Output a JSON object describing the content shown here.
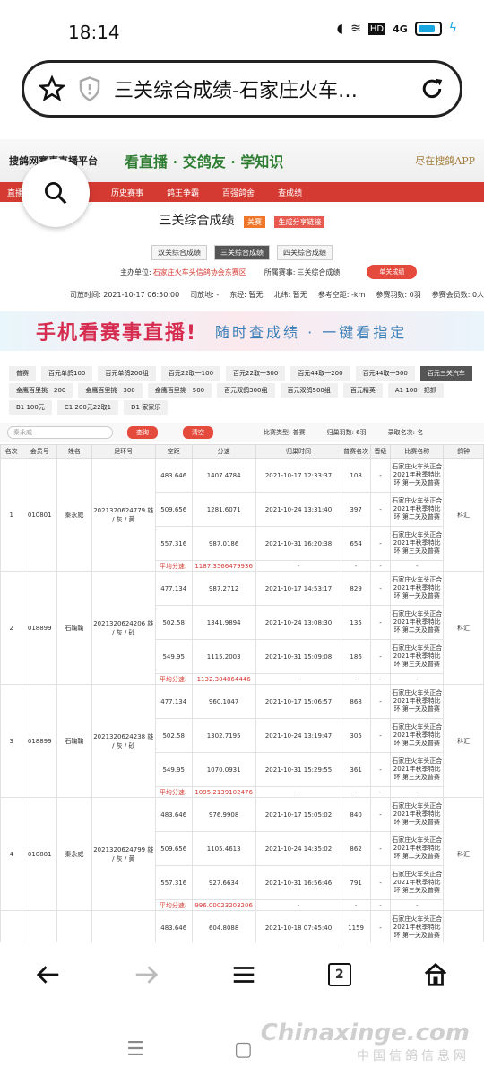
{
  "status": {
    "time": "18:14",
    "net": "HD",
    "signal": "4G"
  },
  "browser": {
    "title": "三关综合成绩-石家庄火车…",
    "tab_count": "2"
  },
  "site": {
    "brand": "搜鸽网赛事直播平台",
    "slogan": "看直播 · 交鸽友 · 学知识",
    "slogan2": "尽在搜鸽APP",
    "nav": [
      "直播",
      "历史赛事",
      "鸽王争霸",
      "百强鸽舍",
      "查成绩"
    ]
  },
  "page": {
    "title": "三关综合成绩",
    "tag_race": "关赛",
    "tag_share": "生成分享链接",
    "tabs": [
      "双关综合成绩",
      "三关综合成绩",
      "四关综合成绩"
    ],
    "organizer_label": "主办单位:",
    "organizer": "石家庄火车头信鸽协会东赛区",
    "match_label": "所属赛事:",
    "match": "三关综合成绩",
    "single_btn": "单关成绩",
    "release_time": "司放时间: 2021-10-17 06:50:00",
    "release_place": "司放地: -",
    "east": "东经: 暂无",
    "north": "北纬: 暂无",
    "ref_dist": "参考空距: -km",
    "ref_feathers": "参赛羽数: 0羽",
    "ref_members": "参赛会员数: 0人"
  },
  "banner": {
    "left": "手机看赛事直播!",
    "right": "随时查成绩 · 一键看指定"
  },
  "categories": [
    "普赛",
    "百元单鸽100",
    "百元单鸽200组",
    "百元22取一100",
    "百元22取一300",
    "百元44取一200",
    "百元44取一500",
    "百元三关汽车",
    "金鹰百里挑一200",
    "金鹰百里挑一300",
    "金鹰百里挑一500",
    "百元双鸽300组",
    "百元双鸽500组",
    "百元精英",
    "A1 100一把抓",
    "B1 100元",
    "C1 200元22取1",
    "D1 家家乐"
  ],
  "filters": {
    "search_value": "秦永威",
    "query_btn": "查询",
    "clear_btn": "清空",
    "type": "比赛类型: 普赛",
    "feathers": "归巢羽数: 6羽",
    "take": "录取名次: 名"
  },
  "table": {
    "headers": [
      "名次",
      "会员号",
      "姓名",
      "足环号",
      "空距",
      "分速",
      "归巢时间",
      "普赛名次",
      "晋级",
      "比赛名称",
      "鸽钟"
    ],
    "avg_label": "平均分速:",
    "rows": [
      {
        "rank": "1",
        "member": "010801",
        "name": "秦永威",
        "ring": "2021320624779 雄 / 灰 / 黄",
        "clock": "科汇",
        "avg": "1187.3566479936",
        "legs": [
          {
            "dist": "483.646",
            "speed": "1407.4784",
            "time": "2021-10-17 12:33:37",
            "place": "108",
            "adv": "-",
            "race": "石家庄火车头正合 2021年秋季特比环 第一关及普赛"
          },
          {
            "dist": "509.656",
            "speed": "1281.6071",
            "time": "2021-10-24 13:31:40",
            "place": "397",
            "adv": "-",
            "race": "石家庄火车头正合 2021年秋季特比环 第二关及普赛"
          },
          {
            "dist": "557.316",
            "speed": "987.0186",
            "time": "2021-10-31 16:20:38",
            "place": "654",
            "adv": "-",
            "race": "石家庄火车头正合 2021年秋季特比环 第三关及普赛"
          }
        ]
      },
      {
        "rank": "2",
        "member": "018899",
        "name": "石鞠鞠",
        "ring": "2021320624206 雄 / 灰 / 砂",
        "clock": "科汇",
        "avg": "1132.304864446",
        "legs": [
          {
            "dist": "477.134",
            "speed": "987.2712",
            "time": "2021-10-17 14:53:17",
            "place": "829",
            "adv": "-",
            "race": "石家庄火车头正合 2021年秋季特比环 第一关及普赛"
          },
          {
            "dist": "502.58",
            "speed": "1341.9894",
            "time": "2021-10-24 13:08:30",
            "place": "135",
            "adv": "-",
            "race": "石家庄火车头正合 2021年秋季特比环 第二关及普赛"
          },
          {
            "dist": "549.95",
            "speed": "1115.2003",
            "time": "2021-10-31 15:09:08",
            "place": "186",
            "adv": "-",
            "race": "石家庄火车头正合 2021年秋季特比环 第三关及普赛"
          }
        ]
      },
      {
        "rank": "3",
        "member": "018899",
        "name": "石鞠鞠",
        "ring": "2021320624238 雄 / 灰 / 砂",
        "clock": "科汇",
        "avg": "1095.2139102476",
        "legs": [
          {
            "dist": "477.134",
            "speed": "960.1047",
            "time": "2021-10-17 15:06:57",
            "place": "868",
            "adv": "-",
            "race": "石家庄火车头正合 2021年秋季特比环 第一关及普赛"
          },
          {
            "dist": "502.58",
            "speed": "1302.7195",
            "time": "2021-10-24 13:19:47",
            "place": "305",
            "adv": "-",
            "race": "石家庄火车头正合 2021年秋季特比环 第二关及普赛"
          },
          {
            "dist": "549.95",
            "speed": "1070.0931",
            "time": "2021-10-31 15:29:55",
            "place": "361",
            "adv": "-",
            "race": "石家庄火车头正合 2021年秋季特比环 第三关及普赛"
          }
        ]
      },
      {
        "rank": "4",
        "member": "010801",
        "name": "秦永威",
        "ring": "2021320624799 雄 / 灰 / 黄",
        "clock": "科汇",
        "avg": "996.00023203206",
        "legs": [
          {
            "dist": "483.646",
            "speed": "976.9908",
            "time": "2021-10-17 15:05:02",
            "place": "840",
            "adv": "-",
            "race": "石家庄火车头正合 2021年秋季特比环 第一关及普赛"
          },
          {
            "dist": "509.656",
            "speed": "1105.4613",
            "time": "2021-10-24 14:35:02",
            "place": "862",
            "adv": "-",
            "race": "石家庄火车头正合 2021年秋季特比环 第二关及普赛"
          },
          {
            "dist": "557.316",
            "speed": "927.6634",
            "time": "2021-10-31 16:56:46",
            "place": "791",
            "adv": "-",
            "race": "石家庄火车头正合 2021年秋季特比环 第三关及普赛"
          }
        ]
      }
    ],
    "partial_row": {
      "dist": "483.646",
      "speed": "604.8088",
      "time": "2021-10-18 07:45:40",
      "place": "1159",
      "adv": "-",
      "race": "石家庄火车头正合 2021年秋季特比环 第一关及普赛"
    }
  },
  "watermark": {
    "line1": "Chinaxinge.com",
    "line2": "中国信鸽信息网"
  }
}
